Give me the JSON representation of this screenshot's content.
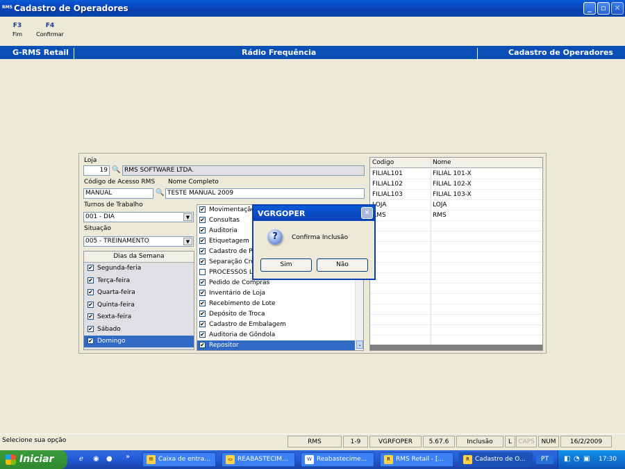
{
  "window": {
    "title": "Cadastro de Operadores",
    "app_icon": "RMS"
  },
  "fkeys": [
    {
      "key": "F3",
      "label": "Fim"
    },
    {
      "key": "F4",
      "label": "Confirmar"
    }
  ],
  "header": {
    "left": "G-RMS Retail",
    "center": "Rádio Frequência",
    "right": "Cadastro de Operadores"
  },
  "form": {
    "loja_label": "Loja",
    "loja_code": "19",
    "loja_name": "RMS SOFTWARE LTDA.",
    "codigo_label": "Código de Acesso RMS",
    "codigo_value": "MANUAL",
    "nome_label": "Nome Completo",
    "nome_value": "TESTE MANUAL 2009",
    "turnos_label": "Turnos de Trabalho",
    "turnos_value": "001 - DIA",
    "situacao_label": "Situação",
    "situacao_value": "005 - TREINAMENTO",
    "dias_header": "Dias da Semana",
    "dias": [
      "Segunda-feria",
      "Terça-feira",
      "Quarta-feira",
      "Quinta-feira",
      "Sexta-feira",
      "Sábado",
      "Domingo"
    ],
    "processos": [
      {
        "label": "Movimentação",
        "checked": true
      },
      {
        "label": "Consultas",
        "checked": true
      },
      {
        "label": "Auditoria",
        "checked": true
      },
      {
        "label": "Etiquetagem",
        "checked": true
      },
      {
        "label": "Cadastro de P",
        "checked": true
      },
      {
        "label": "Separação Cro",
        "checked": true
      },
      {
        "label": "PROCESSOS L",
        "checked": false
      },
      {
        "label": "Pedido de Compras",
        "checked": true
      },
      {
        "label": "Inventário de Loja",
        "checked": true
      },
      {
        "label": "Recebimento de Lote",
        "checked": true
      },
      {
        "label": "Depósito de Troca",
        "checked": true
      },
      {
        "label": "Cadastro de Embalagem",
        "checked": true
      },
      {
        "label": "Auditoria de Gôndola",
        "checked": true
      },
      {
        "label": "Repositor",
        "checked": true
      }
    ]
  },
  "grid": {
    "col_codigo": "Codigo",
    "col_nome": "Nome",
    "rows": [
      {
        "codigo": "FILIAL101",
        "nome": "FILIAL 101-X"
      },
      {
        "codigo": "FILIAL102",
        "nome": "FILIAL 102-X"
      },
      {
        "codigo": "FILIAL103",
        "nome": "FILIAL 103-X"
      },
      {
        "codigo": "LOJA",
        "nome": "LOJA"
      },
      {
        "codigo": "RMS",
        "nome": "RMS"
      }
    ]
  },
  "dialog": {
    "title": "VGRGOPER",
    "message": "Confirma Inclusão",
    "yes": "Sim",
    "no": "Não",
    "icon": "question-icon"
  },
  "status": {
    "message": "Selecione sua opção",
    "system": "RMS",
    "range": "1-9",
    "program": "VGRFOPER",
    "version": "5.67.6",
    "mode": "Inclusão",
    "l": "L",
    "caps": "CAPS",
    "num": "NUM",
    "date": "16/2/2009"
  },
  "taskbar": {
    "start": "Iniciar",
    "chevron": "»",
    "tasks": [
      "Caixa de entra...",
      "REABASTECIM...",
      "Reabasteci­me...",
      "RMS Retail - [...",
      "Cadastro de O..."
    ],
    "lang": "PT",
    "clock": "17:30"
  },
  "colors": {
    "titlebar": "#0a4fb5",
    "selection": "#316ac5",
    "start": "#2f8a2f"
  }
}
